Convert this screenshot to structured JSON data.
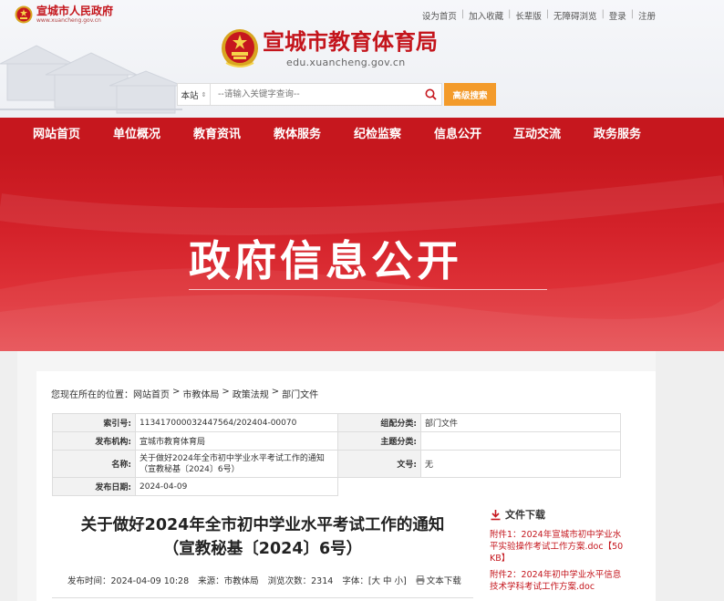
{
  "header": {
    "gov_name": "宣城市人民政府",
    "gov_domain": "www.xuancheng.gov.cn",
    "top_links": [
      "设为首页",
      "加入收藏",
      "长辈版",
      "无障碍浏览",
      "登录",
      "注册"
    ],
    "site_title": "宣城市教育体育局",
    "site_domain": "edu.xuancheng.gov.cn",
    "search": {
      "scope": "本站",
      "placeholder": "--请输入关键字查询--",
      "advanced_label": "高级搜索"
    }
  },
  "nav": {
    "items": [
      "网站首页",
      "单位概况",
      "教育资讯",
      "教体服务",
      "纪检监察",
      "信息公开",
      "互动交流",
      "政务服务"
    ]
  },
  "banner": {
    "title": "政府信息公开"
  },
  "breadcrumb": {
    "prefix": "您现在所在的位置：",
    "items": [
      "网站首页",
      "市教体局",
      "政策法规",
      "部门文件"
    ],
    "sep": ">"
  },
  "meta": {
    "index_label": "索引号:",
    "index_value": "11341700003244 7564/202404-00070",
    "index_value_exact": "113417000032447564/202404-00070",
    "subject_cat_label": "组配分类:",
    "subject_cat_value": "部门文件",
    "publisher_label": "发布机构:",
    "publisher_value": "宣城市教育体育局",
    "topic_label": "主题分类:",
    "topic_value": "",
    "name_label": "名称:",
    "name_value": "关于做好2024年全市初中学业水平考试工作的通知（宣教秘基〔2024〕6号）",
    "docno_label": "文号:",
    "docno_value": "无",
    "date_label": "发布日期:",
    "date_value": "2024-04-09"
  },
  "article": {
    "title_line1": "关于做好2024年全市初中学业水平考试工作的通知",
    "title_line2": "（宣教秘基〔2024〕6号）",
    "publish_time": "发布时间：2024-04-09 10:28",
    "source": "来源：市教体局",
    "views": "浏览次数：2314",
    "font_size": "字体：[大 中 小]",
    "text_download": "文本下载"
  },
  "downloads": {
    "heading": "文件下载",
    "items": [
      "附件1：2024年宣城市初中学业水平实验操作考试工作方案.doc【50 KB】",
      "附件2：2024年初中学业水平信息技术学科考试工作方案.doc"
    ]
  },
  "colors": {
    "brand_red": "#c6171e",
    "accent_orange": "#f39b2b"
  }
}
